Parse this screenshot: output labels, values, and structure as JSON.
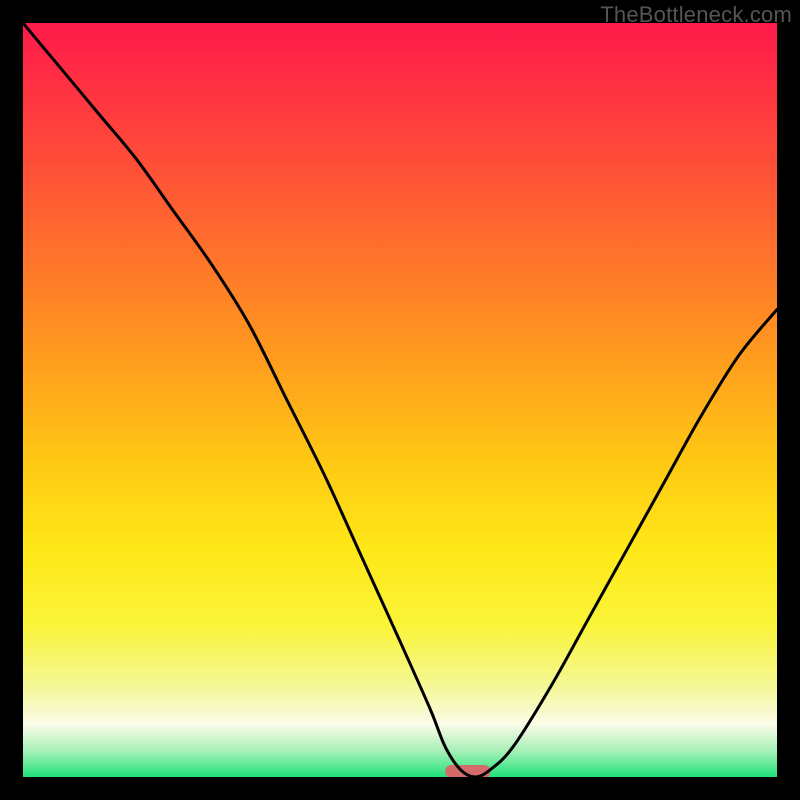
{
  "watermark": {
    "text": "TheBottleneck.com"
  },
  "chart_data": {
    "type": "line",
    "title": "",
    "xlabel": "",
    "ylabel": "",
    "xlim": [
      0,
      100
    ],
    "ylim": [
      0,
      100
    ],
    "grid": false,
    "legend": false,
    "series": [
      {
        "name": "bottleneck-curve",
        "x": [
          0,
          5,
          10,
          15,
          20,
          25,
          30,
          35,
          40,
          45,
          50,
          54,
          56,
          58,
          60,
          62,
          65,
          70,
          75,
          80,
          85,
          90,
          95,
          100
        ],
        "y": [
          100,
          94,
          88,
          82,
          75,
          68,
          60,
          50,
          40,
          29,
          18,
          9,
          4,
          1,
          0,
          1,
          4,
          12,
          21,
          30,
          39,
          48,
          56,
          62
        ]
      }
    ],
    "optimal_marker": {
      "x_center": 59,
      "x_width": 6,
      "y": 0,
      "color": "#d46a6a"
    },
    "background_gradient": {
      "stops": [
        {
          "offset": 0.0,
          "color": "#ff1a4a"
        },
        {
          "offset": 0.12,
          "color": "#ff3b3f"
        },
        {
          "offset": 0.28,
          "color": "#ff6a2e"
        },
        {
          "offset": 0.44,
          "color": "#ff9a1e"
        },
        {
          "offset": 0.58,
          "color": "#ffc814"
        },
        {
          "offset": 0.7,
          "color": "#ffe818"
        },
        {
          "offset": 0.8,
          "color": "#faf43a"
        },
        {
          "offset": 0.88,
          "color": "#f4f896"
        },
        {
          "offset": 0.93,
          "color": "#fbfbe8"
        },
        {
          "offset": 0.965,
          "color": "#a8f0b8"
        },
        {
          "offset": 1.0,
          "color": "#1fe27a"
        }
      ]
    }
  }
}
